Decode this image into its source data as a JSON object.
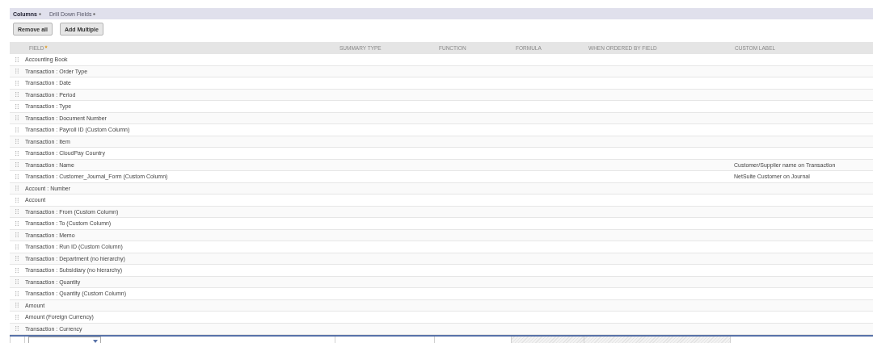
{
  "tabs": [
    {
      "label": "Columns",
      "selected": true
    },
    {
      "label": "Drill Down Fields",
      "selected": false
    }
  ],
  "buttons": [
    "Remove all",
    "Add Multiple"
  ],
  "columns": [
    {
      "label": "FIELD",
      "required": true
    },
    {
      "label": "SUMMARY TYPE",
      "required": false
    },
    {
      "label": "FUNCTION",
      "required": false
    },
    {
      "label": "FORMULA",
      "required": false
    },
    {
      "label": "WHEN ORDERED BY FIELD",
      "required": false
    },
    {
      "label": "CUSTOM LABEL",
      "required": false
    }
  ],
  "rows": [
    {
      "field": "Accounting Book"
    },
    {
      "field": "Transaction : Order Type"
    },
    {
      "field": "Transaction : Date"
    },
    {
      "field": "Transaction : Period"
    },
    {
      "field": "Transaction : Type"
    },
    {
      "field": "Transaction : Document Number"
    },
    {
      "field": "Transaction : Payroll ID (Custom Column)"
    },
    {
      "field": "Transaction : Item"
    },
    {
      "field": "Transaction : CloudPay Country"
    },
    {
      "field": "Transaction : Name",
      "custom_label": "Customer/Supplier name on Transaction"
    },
    {
      "field": "Transaction : Customer_Journal_Form (Custom Column)",
      "custom_label": "NetSuite Customer on Journal"
    },
    {
      "field": "Account : Number"
    },
    {
      "field": "Account"
    },
    {
      "field": "Transaction : From (Custom Column)"
    },
    {
      "field": "Transaction : To (Custom Column)"
    },
    {
      "field": "Transaction : Memo"
    },
    {
      "field": "Transaction : Run ID (Custom Column)"
    },
    {
      "field": "Transaction : Department (no hierarchy)"
    },
    {
      "field": "Transaction : Subsidiary (no hierarchy)"
    },
    {
      "field": "Transaction : Quantity"
    },
    {
      "field": "Transaction : Quantity (Custom Column)"
    },
    {
      "field": "Amount"
    },
    {
      "field": "Amount (Foreign Currency)"
    },
    {
      "field": "Transaction : Currency"
    }
  ]
}
